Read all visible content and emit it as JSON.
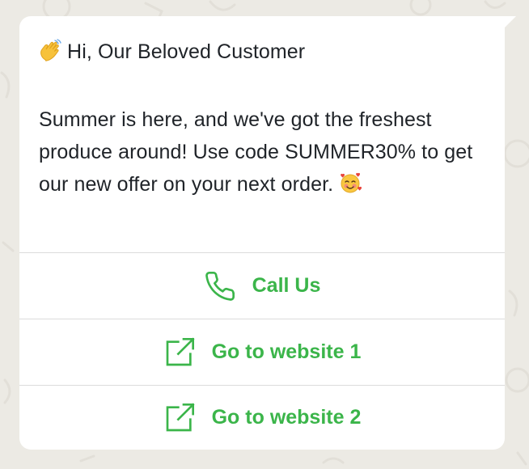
{
  "message": {
    "greeting_emoji": "waving-hand-emoji",
    "greeting": "Hi, Our Beloved Customer",
    "body": "Summer is here, and we've got the freshest produce around! Use code SUMMER30% to get our new offer on your next order.",
    "closing_emoji": "smiling-face-with-hearts-emoji"
  },
  "actions": [
    {
      "label": "Call Us",
      "icon": "phone-icon"
    },
    {
      "label": "Go to website 1",
      "icon": "external-link-icon"
    },
    {
      "label": "Go to website 2",
      "icon": "external-link-icon"
    }
  ],
  "colors": {
    "accent": "#3bb54a",
    "background": "#eceae4",
    "bubble": "#ffffff",
    "text": "#1f2328",
    "divider": "#dcdcdc"
  }
}
